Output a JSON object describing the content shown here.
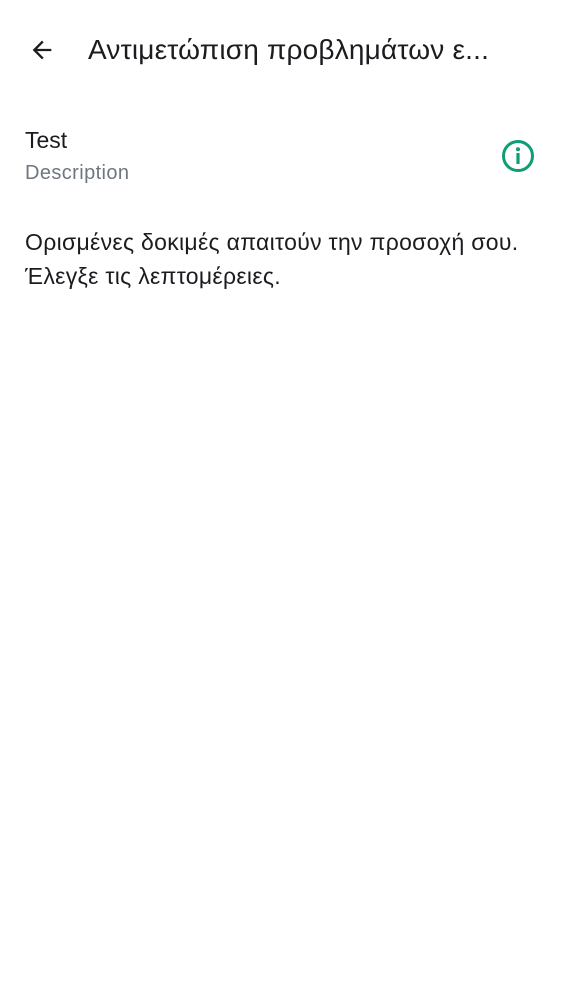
{
  "app_bar": {
    "back_icon": "arrow-back-icon",
    "title": "Αντιμετώπιση προβλημάτων ε..."
  },
  "test_item": {
    "name": "Test",
    "description": "Description",
    "status_icon": "info-outline-icon",
    "status_color": "#0f9d75"
  },
  "message": "Ορισμένες δοκιμές απαιτούν την προσοχή σου. Έλεγξε τις λεπτομέρειες.",
  "colors": {
    "text_primary": "#1c1b1f",
    "text_secondary": "#6f7680",
    "background": "#ffffff"
  }
}
